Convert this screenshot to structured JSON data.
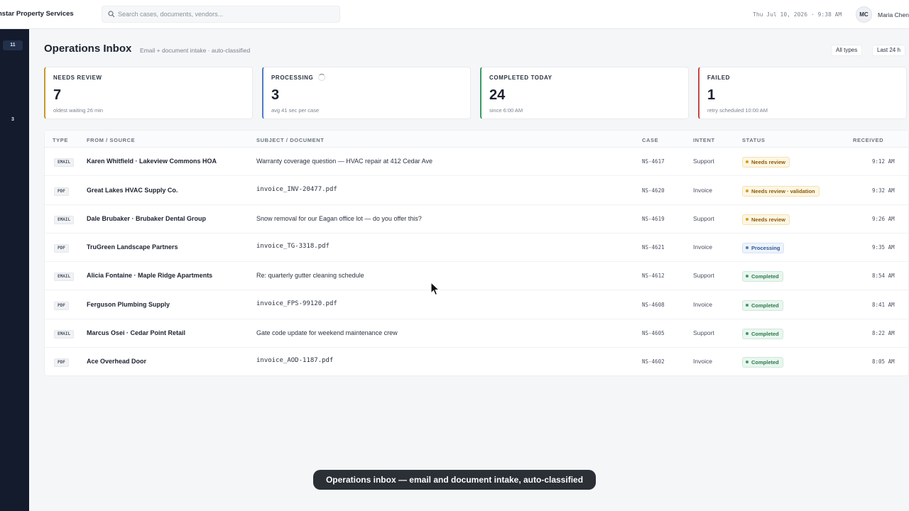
{
  "app": {
    "brand": "nstar Property Services"
  },
  "search": {
    "placeholder": "Search cases, documents, vendors..."
  },
  "header_bar": {
    "datetime": "Thu Jul 10, 2026 · 9:38 AM",
    "avatar_initials": "MC",
    "user_name": "Maria Chen"
  },
  "sidebar": {
    "badges": [
      "11",
      "3"
    ]
  },
  "page": {
    "title": "Operations Inbox",
    "subtitle": "Email + document intake · auto-classified",
    "filters": [
      "All types",
      "Last 24 h"
    ]
  },
  "stats": [
    {
      "label": "NEEDS REVIEW",
      "value": "7",
      "sub": "oldest waiting 26 min",
      "accent": "#c9962a"
    },
    {
      "label": "PROCESSING",
      "value": "3",
      "sub": "avg 41 sec per case",
      "accent": "#4f7cc2"
    },
    {
      "label": "COMPLETED TODAY",
      "value": "24",
      "sub": "since 6:00 AM",
      "accent": "#3a9a64"
    },
    {
      "label": "FAILED",
      "value": "1",
      "sub": "retry scheduled 10:00 AM",
      "accent": "#c64545"
    }
  ],
  "table": {
    "columns": [
      "TYPE",
      "FROM / SOURCE",
      "SUBJECT / DOCUMENT",
      "CASE",
      "INTENT",
      "STATUS",
      "RECEIVED"
    ],
    "rows": [
      {
        "type": "EMAIL",
        "from": "Karen Whitfield · Lakeview Commons HOA",
        "subject": "Warranty coverage question — HVAC repair at 412 Cedar Ave",
        "case": "NS-4617",
        "intent": "Support",
        "status": "Needs review",
        "received": "9:12 AM"
      },
      {
        "type": "PDF",
        "from": "Great Lakes HVAC Supply Co.",
        "subject": "invoice_INV-20477.pdf",
        "case": "NS-4620",
        "intent": "Invoice",
        "status": "Needs review · validation",
        "received": "9:32 AM"
      },
      {
        "type": "EMAIL",
        "from": "Dale Brubaker · Brubaker Dental Group",
        "subject": "Snow removal for our Eagan office lot — do you offer this?",
        "case": "NS-4619",
        "intent": "Support",
        "status": "Needs review",
        "received": "9:26 AM"
      },
      {
        "type": "PDF",
        "from": "TruGreen Landscape Partners",
        "subject": "invoice_TG-3318.pdf",
        "case": "NS-4621",
        "intent": "Invoice",
        "status": "Processing",
        "received": "9:35 AM"
      },
      {
        "type": "EMAIL",
        "from": "Alicia Fontaine · Maple Ridge Apartments",
        "subject": "Re: quarterly gutter cleaning schedule",
        "case": "NS-4612",
        "intent": "Support",
        "status": "Completed",
        "received": "8:54 AM"
      },
      {
        "type": "PDF",
        "from": "Ferguson Plumbing Supply",
        "subject": "invoice_FPS-99120.pdf",
        "case": "NS-4608",
        "intent": "Invoice",
        "status": "Completed",
        "received": "8:41 AM"
      },
      {
        "type": "EMAIL",
        "from": "Marcus Osei · Cedar Point Retail",
        "subject": "Gate code update for weekend maintenance crew",
        "case": "NS-4605",
        "intent": "Support",
        "status": "Completed",
        "received": "8:22 AM"
      },
      {
        "type": "PDF",
        "from": "Ace Overhead Door",
        "subject": "invoice_AOD-1187.pdf",
        "case": "NS-4602",
        "intent": "Invoice",
        "status": "Completed",
        "received": "8:05 AM"
      }
    ]
  },
  "caption": "Operations inbox — email and document intake, auto-classified"
}
